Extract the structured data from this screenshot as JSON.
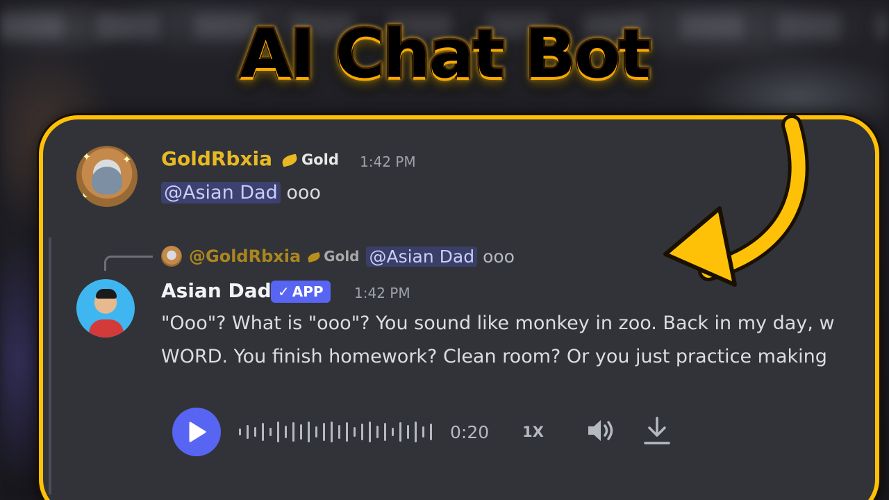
{
  "title": "AI Chat Bot",
  "message1": {
    "username": "GoldRbxia",
    "badge": "Gold",
    "time": "1:42 PM",
    "mention": "@Asian Dad",
    "text": "ooo"
  },
  "reply": {
    "username": "@GoldRbxia",
    "badge": "Gold",
    "mention": "@Asian Dad",
    "text": "ooo"
  },
  "message2": {
    "username": "Asian Dad",
    "app_badge": "APP",
    "time": "1:42 PM",
    "line1": "\"Ooo\"? What is \"ooo\"? You sound like monkey in zoo. Back in my day, w",
    "line2": "WORD. You finish homework? Clean room? Or you just practice making"
  },
  "audio": {
    "duration": "0:20",
    "speed": "1X"
  },
  "colors": {
    "frame": "#ffc107",
    "background": "#313338",
    "blurple": "#5865f2",
    "gold_name": "#e8b923"
  },
  "icons": [
    "play-icon",
    "volume-icon",
    "download-icon",
    "arrow-icon"
  ]
}
